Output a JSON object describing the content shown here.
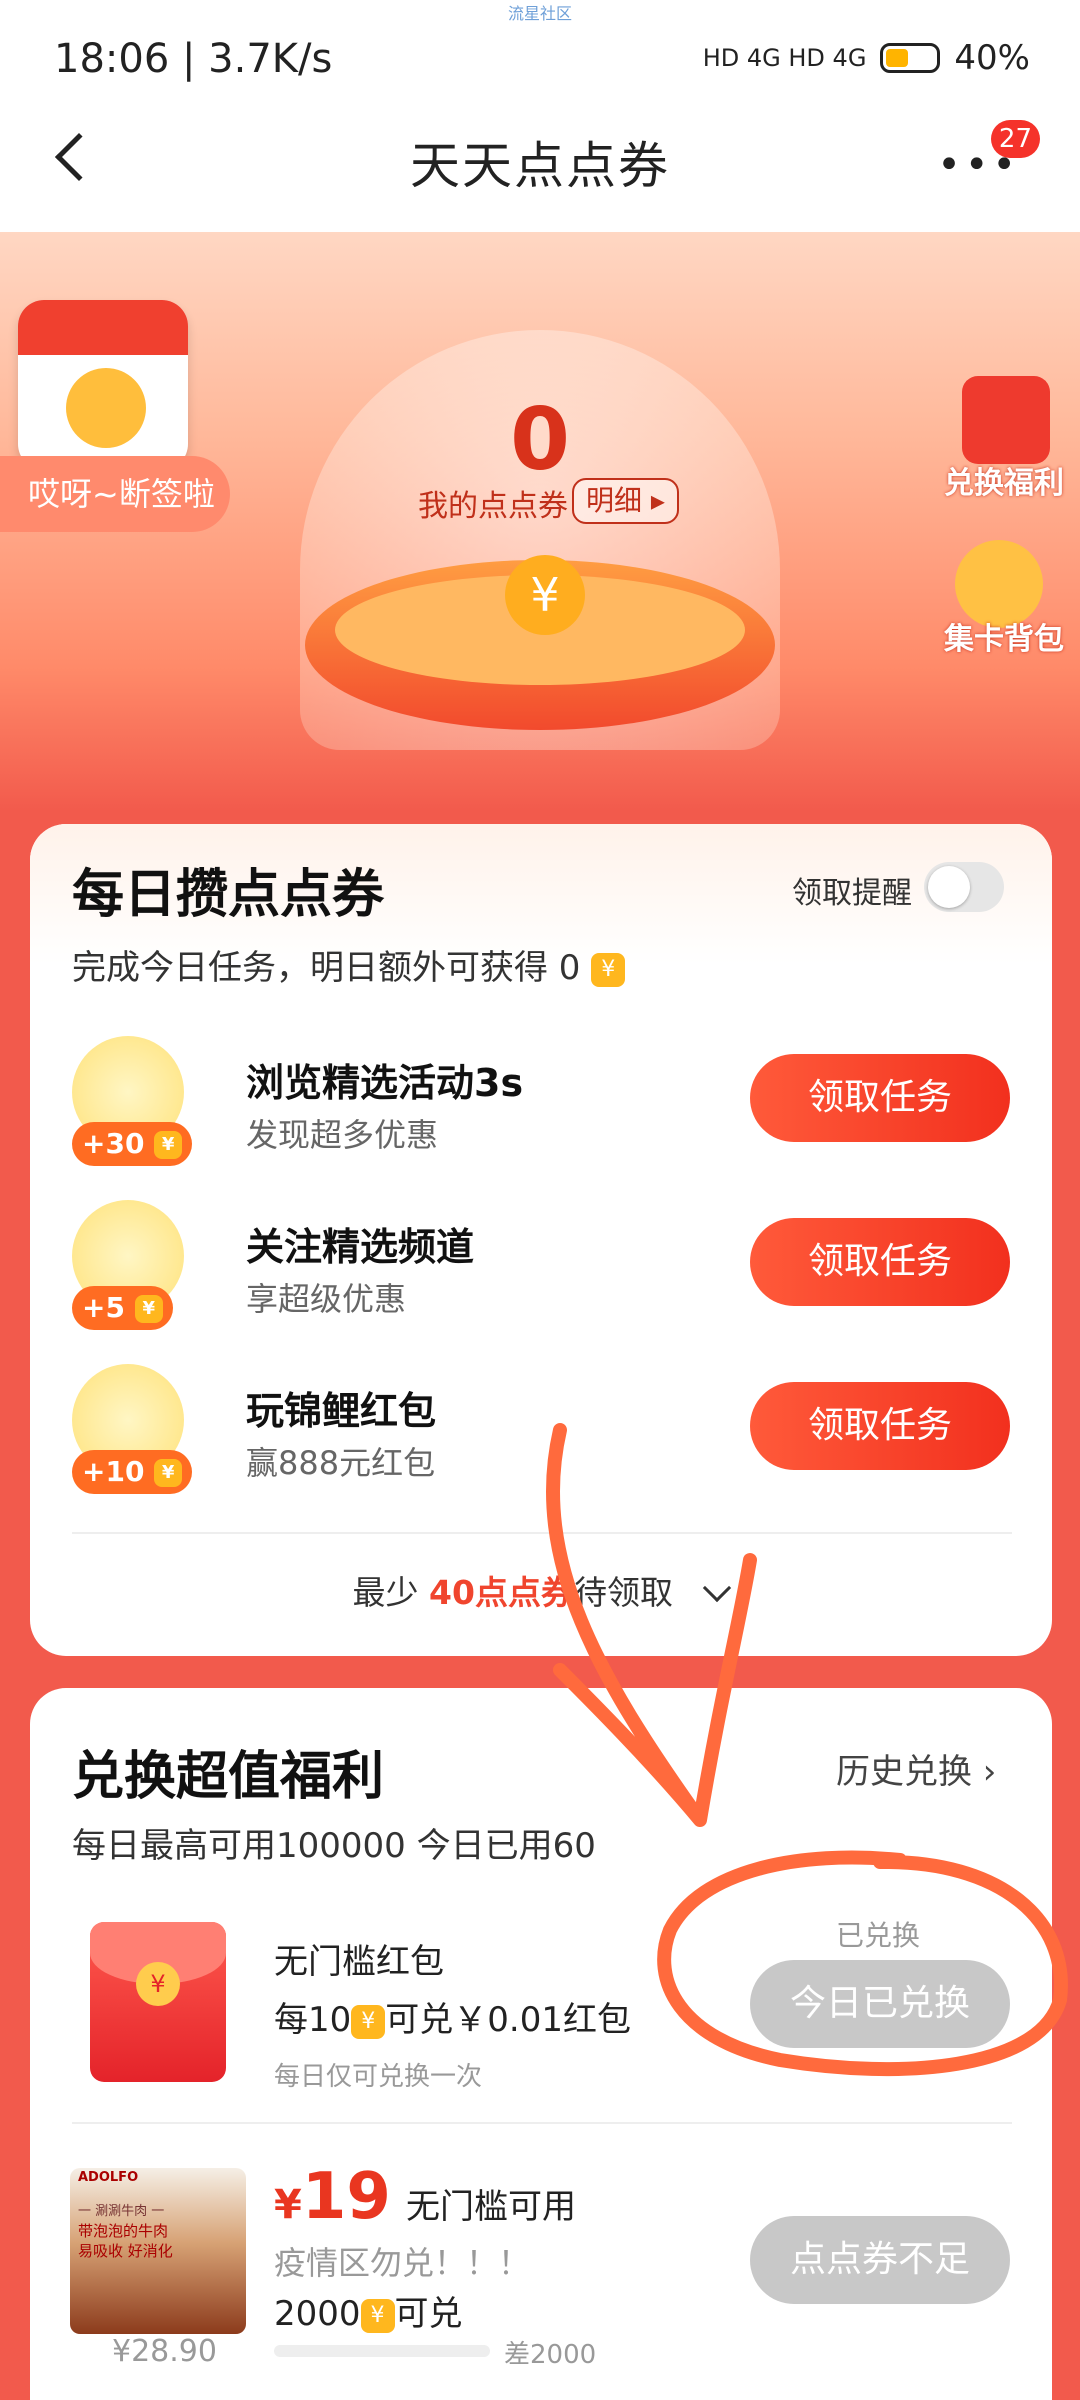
{
  "status": {
    "time": "18:06 | 3.7K/s",
    "battery": "40%",
    "network": "HD 4G HD 4G",
    "watermark": "流星社区"
  },
  "nav": {
    "title": "天天点点券",
    "badge": "27"
  },
  "hero": {
    "points": "0",
    "my_points_label": "我的点点券",
    "detail_label": "明细",
    "calendar_label": "哎呀~断签啦",
    "exchange_label": "兑换福利",
    "card_bag_label": "集卡背包"
  },
  "daily": {
    "title": "每日攒点点券",
    "reminder_label": "领取提醒",
    "subtitle": "完成今日任务，明日额外可获得 0",
    "tasks": [
      {
        "reward": "+30",
        "title": "浏览精选活动3s",
        "sub": "发现超多优惠",
        "button": "领取任务"
      },
      {
        "reward": "+5",
        "title": "关注精选频道",
        "sub": "享超级优惠",
        "button": "领取任务"
      },
      {
        "reward": "+10",
        "title": "玩锦鲤红包",
        "sub": "赢888元红包",
        "button": "领取任务"
      }
    ],
    "min_prefix": "最少",
    "min_highlight": "40点点券",
    "min_suffix": "待领取"
  },
  "exchange": {
    "title": "兑换超值福利",
    "history": "历史兑换",
    "subtitle": "每日最高可用100000 今日已用60",
    "items": [
      {
        "name": "无门槛红包",
        "rule_prefix": "每10",
        "rule_suffix": "可兑￥0.01红包",
        "note": "每日仅可兑换一次",
        "status": "已兑换",
        "button": "今日已兑换"
      },
      {
        "price_symbol": "¥",
        "price": "19",
        "tag": "无门槛可用",
        "warning": "疫情区勿兑！！！",
        "cost_prefix": "2000",
        "cost_suffix": "可兑",
        "orig_price": "¥28.90",
        "gap": "差2000",
        "button": "点点券不足",
        "progress": 0,
        "img_text": {
          "brand": "ADOLFO",
          "line1": "一 涮涮牛肉 一",
          "line2": "带泡泡的牛肉",
          "line3": "易吸收 好消化"
        }
      }
    ]
  },
  "colors": {
    "accent": "#f2301e",
    "annotation": "#ff6a3d"
  }
}
